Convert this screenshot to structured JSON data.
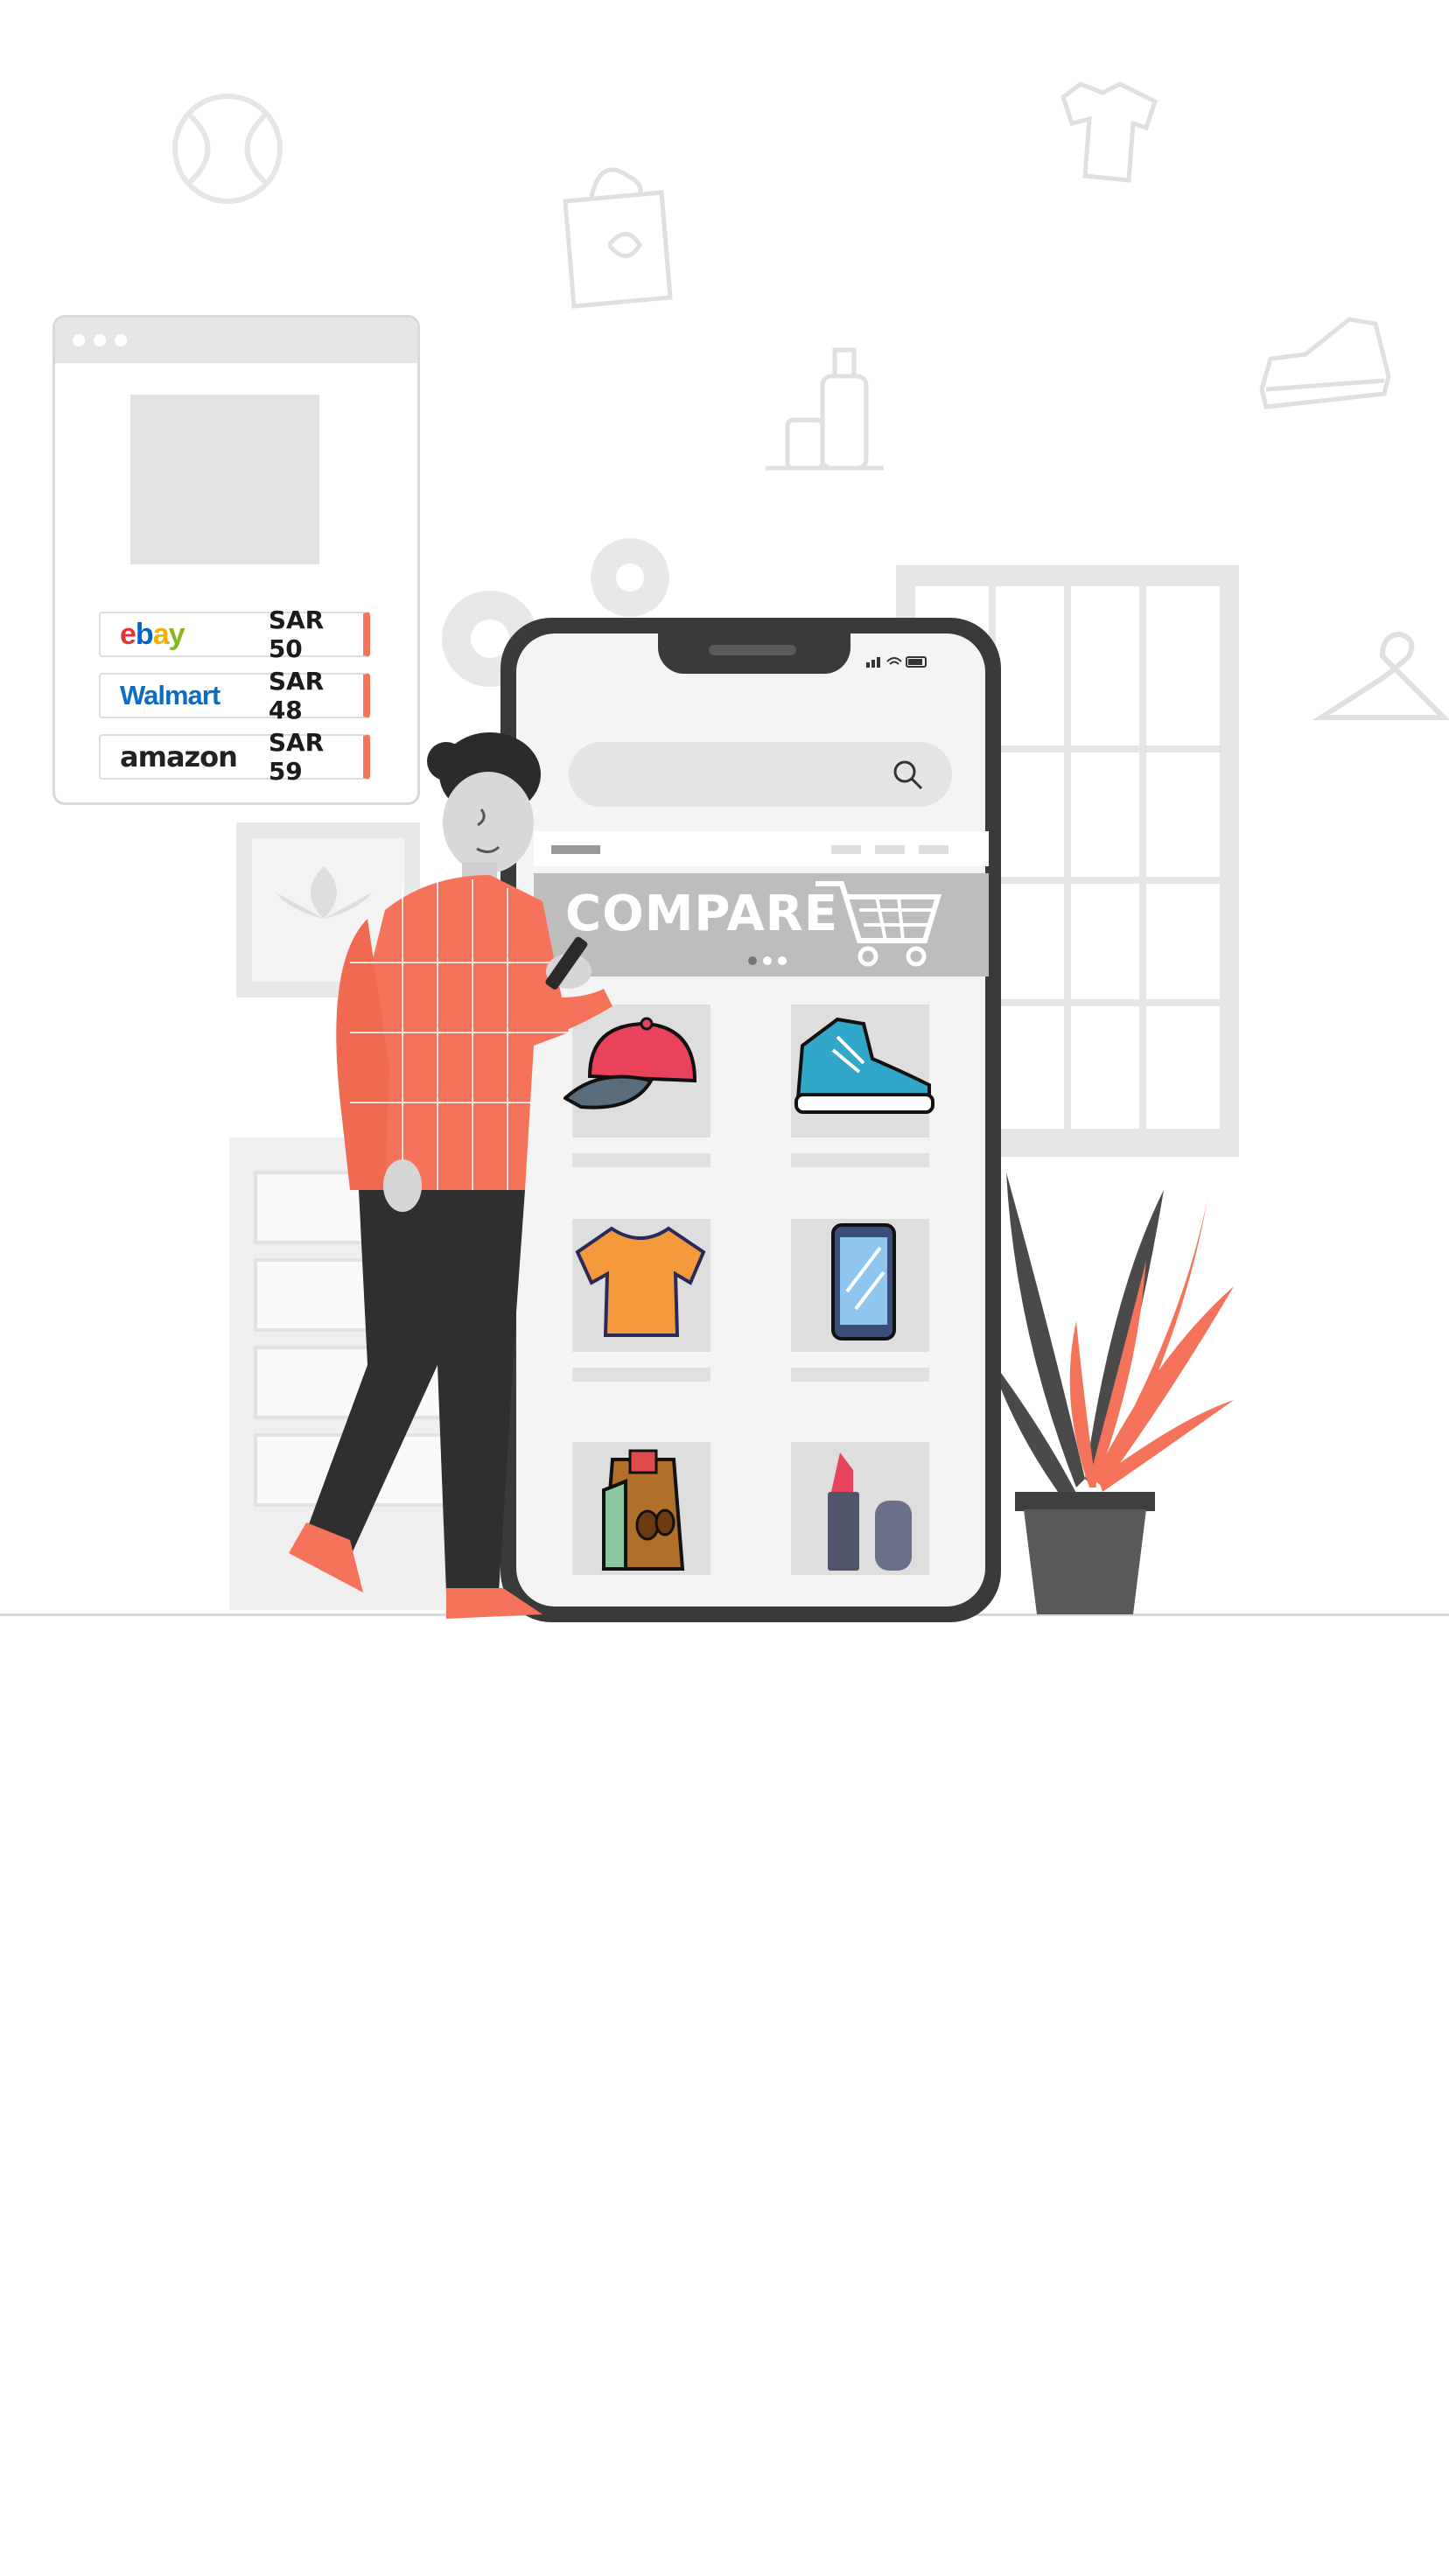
{
  "price_card": {
    "rows": [
      {
        "store": "ebay",
        "price": "SAR 50"
      },
      {
        "store": "Walmart",
        "price": "SAR 48"
      },
      {
        "store": "amazon",
        "price": "SAR 59"
      }
    ]
  },
  "phone": {
    "banner_text": "COMPARE",
    "products": [
      "cap-icon",
      "sneaker-icon",
      "tshirt-icon",
      "smartphone-icon",
      "coffee-bag-icon",
      "lipstick-icon"
    ]
  },
  "colors": {
    "accent": "#f5735a",
    "dark": "#3a3a3a",
    "light_gray": "#e4e4e4"
  }
}
